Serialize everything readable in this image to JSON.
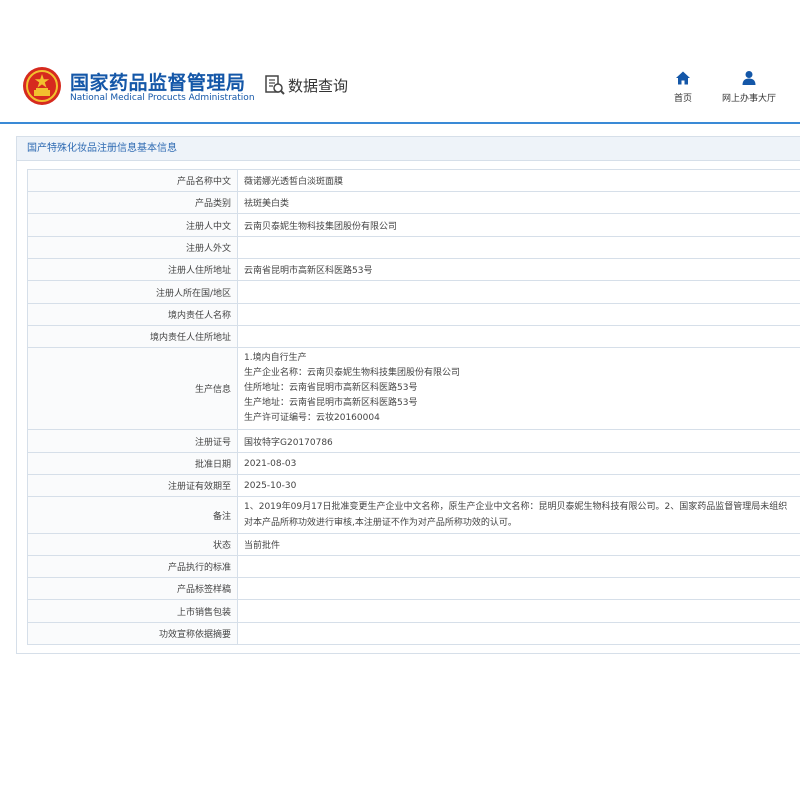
{
  "header": {
    "org_name_cn": "国家药品监督管理局",
    "org_name_en": "National Medical Procucts Administration",
    "query_label": "数据查询",
    "nav": [
      {
        "label": "首页",
        "icon": "home-icon"
      },
      {
        "label": "网上办事大厅",
        "icon": "user-icon"
      }
    ]
  },
  "colors": {
    "brand": "#1457a8",
    "accent_line": "#3a8ad6",
    "panel_head_bg": "#eef3f9",
    "border": "#d6dfe9"
  },
  "panel": {
    "title": "国产特殊化妆品注册信息基本信息"
  },
  "rows": [
    {
      "label": "产品名称中文",
      "value": "薇诺娜光透皙白淡斑面膜"
    },
    {
      "label": "产品类别",
      "value": "祛斑美白类"
    },
    {
      "label": "注册人中文",
      "value": "云南贝泰妮生物科技集团股份有限公司"
    },
    {
      "label": "注册人外文",
      "value": ""
    },
    {
      "label": "注册人住所地址",
      "value": "云南省昆明市高新区科医路53号"
    },
    {
      "label": "注册人所在国/地区",
      "value": ""
    },
    {
      "label": "境内责任人名称",
      "value": ""
    },
    {
      "label": "境内责任人住所地址",
      "value": ""
    },
    {
      "label": "生产信息",
      "lines": [
        "1.境内自行生产",
        "生产企业名称：云南贝泰妮生物科技集团股份有限公司",
        "住所地址：云南省昆明市高新区科医路53号",
        "生产地址：云南省昆明市高新区科医路53号",
        "生产许可证编号：云妆20160004"
      ]
    },
    {
      "label": "注册证号",
      "value": "国妆特字G20170786"
    },
    {
      "label": "批准日期",
      "value": "2021-08-03"
    },
    {
      "label": "注册证有效期至",
      "value": "2025-10-30"
    },
    {
      "label": "备注",
      "value": "1、2019年09月17日批准变更生产企业中文名称，原生产企业中文名称：昆明贝泰妮生物科技有限公司。2、国家药品监督管理局未组织对本产品所称功效进行审核,本注册证不作为对产品所称功效的认可。"
    },
    {
      "label": "状态",
      "value": "当前批件"
    },
    {
      "label": "产品执行的标准",
      "value": ""
    },
    {
      "label": "产品标签样稿",
      "value": ""
    },
    {
      "label": "上市销售包装",
      "value": ""
    },
    {
      "label": "功效宣称依据摘要",
      "value": ""
    }
  ]
}
